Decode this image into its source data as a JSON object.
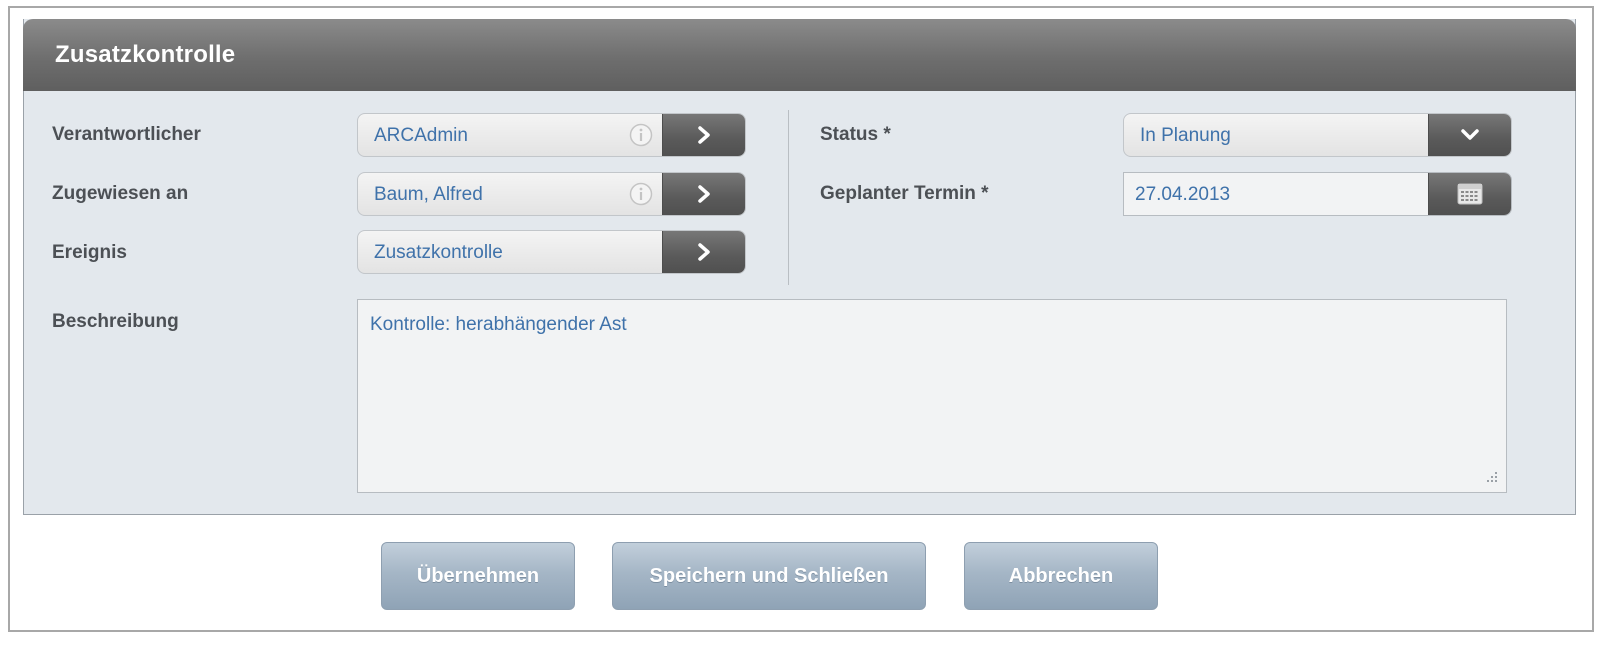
{
  "dialog": {
    "title": "Zusatzkontrolle"
  },
  "fields": {
    "verantwortlicher": {
      "label": "Verantwortlicher",
      "value": "ARCAdmin"
    },
    "zugewiesen_an": {
      "label": "Zugewiesen an",
      "value": "Baum, Alfred"
    },
    "ereignis": {
      "label": "Ereignis",
      "value": "Zusatzkontrolle"
    },
    "status": {
      "label": "Status *",
      "value": "In Planung"
    },
    "geplanter_termin": {
      "label": "Geplanter Termin *",
      "value": "27.04.2013"
    },
    "beschreibung": {
      "label": "Beschreibung",
      "value": "Kontrolle: herabhängender Ast"
    }
  },
  "buttons": {
    "apply": "Übernehmen",
    "save_close": "Speichern und Schließen",
    "cancel": "Abbrechen"
  },
  "icons": {
    "info": "info-icon",
    "select": "chevron-right-icon",
    "dropdown": "chevron-down-icon",
    "calendar": "calendar-icon",
    "resize": "resize-grip-icon"
  },
  "colors": {
    "header": "#6e6e6e",
    "panel": "#e3e8ed",
    "value_text": "#3f72aa",
    "label_text": "#4c5055",
    "button": "#a5b6c6"
  }
}
